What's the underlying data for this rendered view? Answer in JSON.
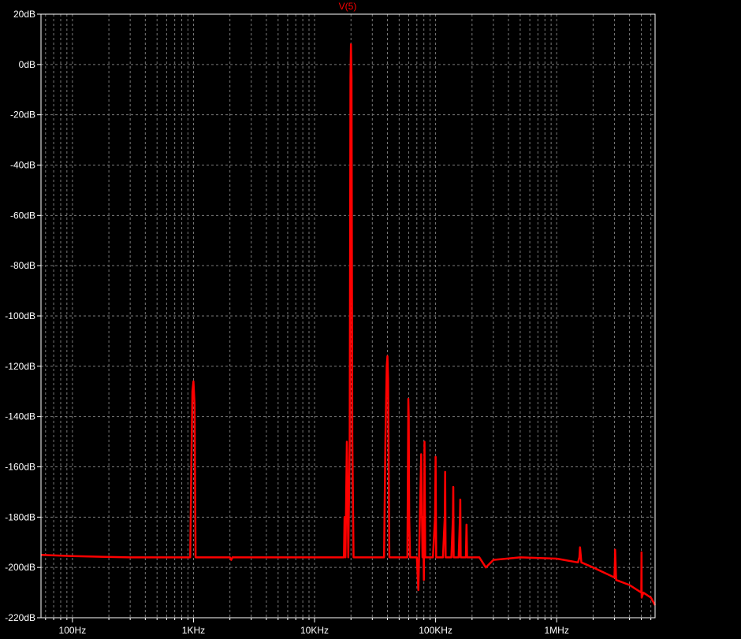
{
  "window": {
    "trace_label": "V(5)"
  },
  "colors": {
    "background": "#000000",
    "trace": "#ff0000",
    "axis_text": "#ffffff",
    "grid": "#7a7a7a",
    "frame": "#ffffff"
  },
  "chart_data": {
    "type": "line",
    "title": "V(5)",
    "xlabel": "",
    "ylabel": "",
    "x_scale": "log",
    "xlim": [
      55,
      6500000
    ],
    "ylim": [
      -220,
      20
    ],
    "grid": true,
    "y_ticks": [
      {
        "value": 20,
        "label": "20dB"
      },
      {
        "value": 0,
        "label": "0dB"
      },
      {
        "value": -20,
        "label": "-20dB"
      },
      {
        "value": -40,
        "label": "-40dB"
      },
      {
        "value": -60,
        "label": "-60dB"
      },
      {
        "value": -80,
        "label": "-80dB"
      },
      {
        "value": -100,
        "label": "-100dB"
      },
      {
        "value": -120,
        "label": "-120dB"
      },
      {
        "value": -140,
        "label": "-140dB"
      },
      {
        "value": -160,
        "label": "-160dB"
      },
      {
        "value": -180,
        "label": "-180dB"
      },
      {
        "value": -200,
        "label": "-200dB"
      },
      {
        "value": -220,
        "label": "-220dB"
      }
    ],
    "x_ticks": [
      {
        "value": 100,
        "label": "100Hz"
      },
      {
        "value": 1000,
        "label": "1KHz"
      },
      {
        "value": 10000,
        "label": "10KHz"
      },
      {
        "value": 100000,
        "label": "100KHz"
      },
      {
        "value": 1000000,
        "label": "1MHz"
      }
    ],
    "series": [
      {
        "name": "V(5)",
        "x": [
          55,
          100,
          300,
          940,
          960,
          980,
          1000,
          1020,
          1040,
          2000,
          2050,
          2100,
          5000,
          17500,
          17700,
          18000,
          18500,
          19000,
          19500,
          19800,
          20000,
          20200,
          20500,
          21000,
          21500,
          22000,
          30000,
          37500,
          38500,
          39500,
          40000,
          40500,
          41500,
          42500,
          50000,
          58500,
          59500,
          60000,
          60500,
          61500,
          70000,
          72000,
          73000,
          76000,
          78000,
          79000,
          80000,
          81000,
          82000,
          88000,
          95000,
          99000,
          100000,
          101000,
          105000,
          110000,
          115000,
          119000,
          120000,
          121000,
          128000,
          135000,
          139000,
          140000,
          141000,
          148000,
          155000,
          159000,
          160000,
          161000,
          170000,
          178000,
          180000,
          182000,
          200000,
          230000,
          260000,
          300000,
          500000,
          1000000,
          1500000,
          1540000,
          1560000,
          1600000,
          2000000,
          3000000,
          3020000,
          3040000,
          3100000,
          4000000,
          5000000,
          5020000,
          5040000,
          5200000,
          6000000,
          6500000
        ],
        "values": [
          -195,
          -195.5,
          -196,
          -196,
          -160,
          -130,
          -126,
          -135,
          -196,
          -196,
          -197,
          -196,
          -196,
          -196,
          -180,
          -196,
          -150,
          -196,
          -150,
          -5,
          8,
          -5,
          -148,
          -196,
          -196,
          -196,
          -196,
          -196,
          -150,
          -120,
          -116,
          -125,
          -196,
          -196,
          -196,
          -196,
          -133,
          -140,
          -180,
          -196,
          -196,
          -209,
          -196,
          -155,
          -196,
          -180,
          -205,
          -150,
          -196,
          -196,
          -196,
          -180,
          -156,
          -196,
          -196,
          -196,
          -196,
          -180,
          -162,
          -196,
          -196,
          -196,
          -180,
          -168,
          -196,
          -196,
          -196,
          -180,
          -173,
          -196,
          -196,
          -196,
          -183,
          -196,
          -196,
          -196,
          -200,
          -197,
          -196,
          -196.5,
          -198,
          -196,
          -192,
          -198,
          -200,
          -204,
          -200,
          -193,
          -205,
          -207,
          -210,
          -194,
          -212,
          -210,
          -212,
          -215
        ]
      }
    ]
  }
}
